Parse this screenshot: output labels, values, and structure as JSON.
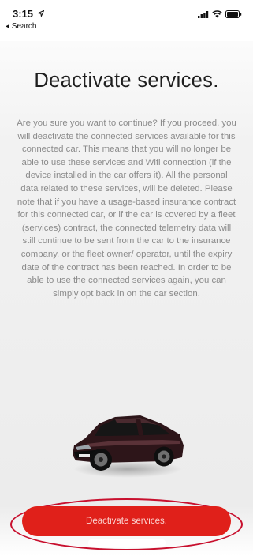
{
  "status_bar": {
    "time": "3:15",
    "back_label": "◂ Search"
  },
  "page": {
    "title": "Deactivate services.",
    "body": "Are you sure you want to continue? If you proceed, you will deactivate the connected services available for this connected car. This means that you will no longer be able to use these services and Wifi connection (if the device installed in the car offers it). All the personal data related to these services, will be deleted. Please note that if you have a usage-based insurance contract for this connected car, or if the car is covered by a fleet (services) contract, the connected telemetry data will still continue to be sent from the car to the insurance company, or the fleet owner/ operator, until the expiry date of the contract has been reached. In order to be able to use the connected services again, you can simply opt back in on the car section."
  },
  "actions": {
    "deactivate_label": "Deactivate services."
  },
  "colors": {
    "accent": "#e0201a",
    "annotation": "#c8102e"
  },
  "icons": {
    "signal": "cellular-signal-icon",
    "wifi": "wifi-icon",
    "battery": "battery-icon",
    "location": "location-arrow-icon",
    "back": "back-chevron-icon"
  }
}
